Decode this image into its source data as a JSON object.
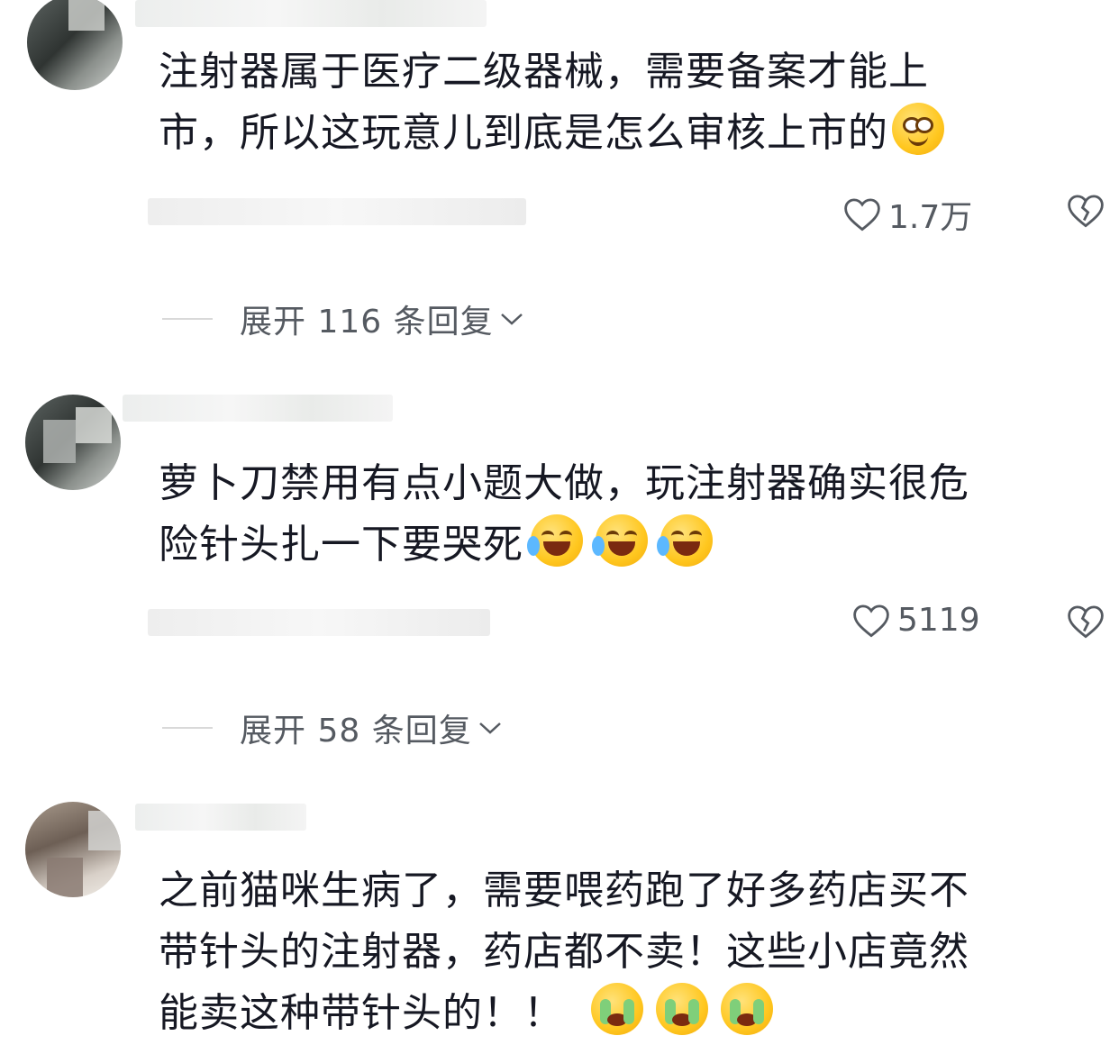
{
  "comments": [
    {
      "text_lines": [
        "注射器属于医疗二级器械，需要备案才能上",
        "市，所以这玩意儿到底是怎么审核上市的"
      ],
      "emojis": [
        "shy"
      ],
      "likes": "1.7万",
      "expand_label": "展开 116 条回复"
    },
    {
      "text_lines": [
        "萝卜刀禁用有点小题大做，玩注射器确实很危",
        "险针头扎一下要哭死"
      ],
      "emojis": [
        "laugh-cry",
        "laugh-cry",
        "laugh-cry"
      ],
      "likes": "5119",
      "expand_label": "展开 58 条回复"
    },
    {
      "text_lines": [
        "之前猫咪生病了，需要喂药跑了好多药店买不",
        "带针头的注射器，药店都不卖！这些小店竟然",
        "能卖这种带针头的！！"
      ],
      "emojis": [
        "cry",
        "cry",
        "cry"
      ]
    }
  ],
  "icons": {
    "like": "heart-outline-icon",
    "dislike": "broken-heart-icon",
    "expand": "chevron-down-icon"
  },
  "colors": {
    "text": "#161823",
    "secondary": "#555a61",
    "divider": "#d9d9d9"
  }
}
